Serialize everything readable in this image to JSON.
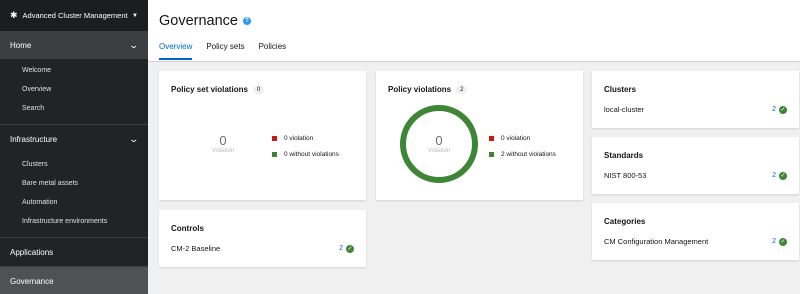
{
  "sidebar": {
    "switcher": "Advanced Cluster Management",
    "groups": [
      {
        "label": "Home",
        "items": [
          "Welcome",
          "Overview",
          "Search"
        ]
      },
      {
        "label": "Infrastructure",
        "items": [
          "Clusters",
          "Bare metal assets",
          "Automation",
          "Infrastructure environments"
        ]
      }
    ],
    "applications": "Applications",
    "governance": "Governance"
  },
  "header": {
    "title": "Governance",
    "tabs": [
      "Overview",
      "Policy sets",
      "Policies"
    ]
  },
  "policy_set_violations": {
    "title": "Policy set violations",
    "count": "0",
    "donut_value": "0",
    "donut_label": "Violation",
    "legend": [
      "0 violation",
      "0 without violations"
    ]
  },
  "policy_violations": {
    "title": "Policy violations",
    "count": "2",
    "donut_value": "0",
    "donut_label": "Violation",
    "legend": [
      "0 violation",
      "2 without violations"
    ],
    "without_violation_fraction": 1.0
  },
  "controls": {
    "title": "Controls",
    "rows": [
      {
        "name": "CM-2 Baseline",
        "count": "2"
      }
    ]
  },
  "clusters": {
    "title": "Clusters",
    "rows": [
      {
        "name": "local-cluster",
        "count": "2"
      }
    ]
  },
  "standards": {
    "title": "Standards",
    "rows": [
      {
        "name": "NIST 800-53",
        "count": "2"
      }
    ]
  },
  "categories": {
    "title": "Categories",
    "rows": [
      {
        "name": "CM Configuration Management",
        "count": "2"
      }
    ]
  },
  "colors": {
    "violation": "#c9190b",
    "without_violation": "#3e8635",
    "link": "#0066cc",
    "sidebar": "#212427"
  }
}
